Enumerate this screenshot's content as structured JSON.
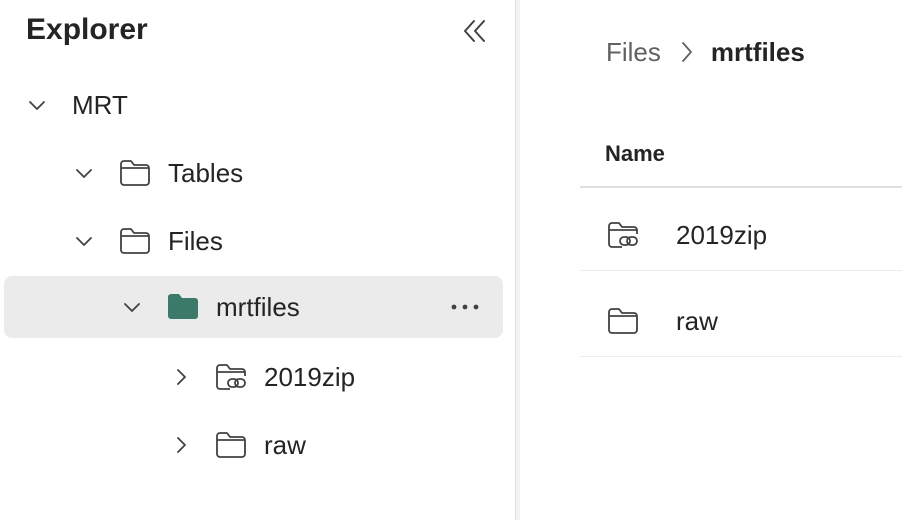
{
  "explorer": {
    "title": "Explorer",
    "collapse_icon": "double-chevron-left-icon",
    "tree": [
      {
        "label": "MRT",
        "expanded": true
      },
      {
        "label": "Tables",
        "icon": "folder-icon",
        "expanded": true
      },
      {
        "label": "Files",
        "icon": "folder-icon",
        "expanded": true
      },
      {
        "label": "mrtfiles",
        "icon": "folder-filled-icon",
        "expanded": true,
        "selected": true,
        "color": "#3b7a69"
      },
      {
        "label": "2019zip",
        "icon": "linked-folder-icon",
        "expanded": false
      },
      {
        "label": "raw",
        "icon": "folder-icon",
        "expanded": false
      }
    ]
  },
  "breadcrumb": {
    "items": [
      "Files",
      "mrtfiles"
    ]
  },
  "table": {
    "header_name": "Name",
    "rows": [
      {
        "name": "2019zip",
        "icon": "linked-folder-icon"
      },
      {
        "name": "raw",
        "icon": "folder-icon"
      }
    ]
  }
}
